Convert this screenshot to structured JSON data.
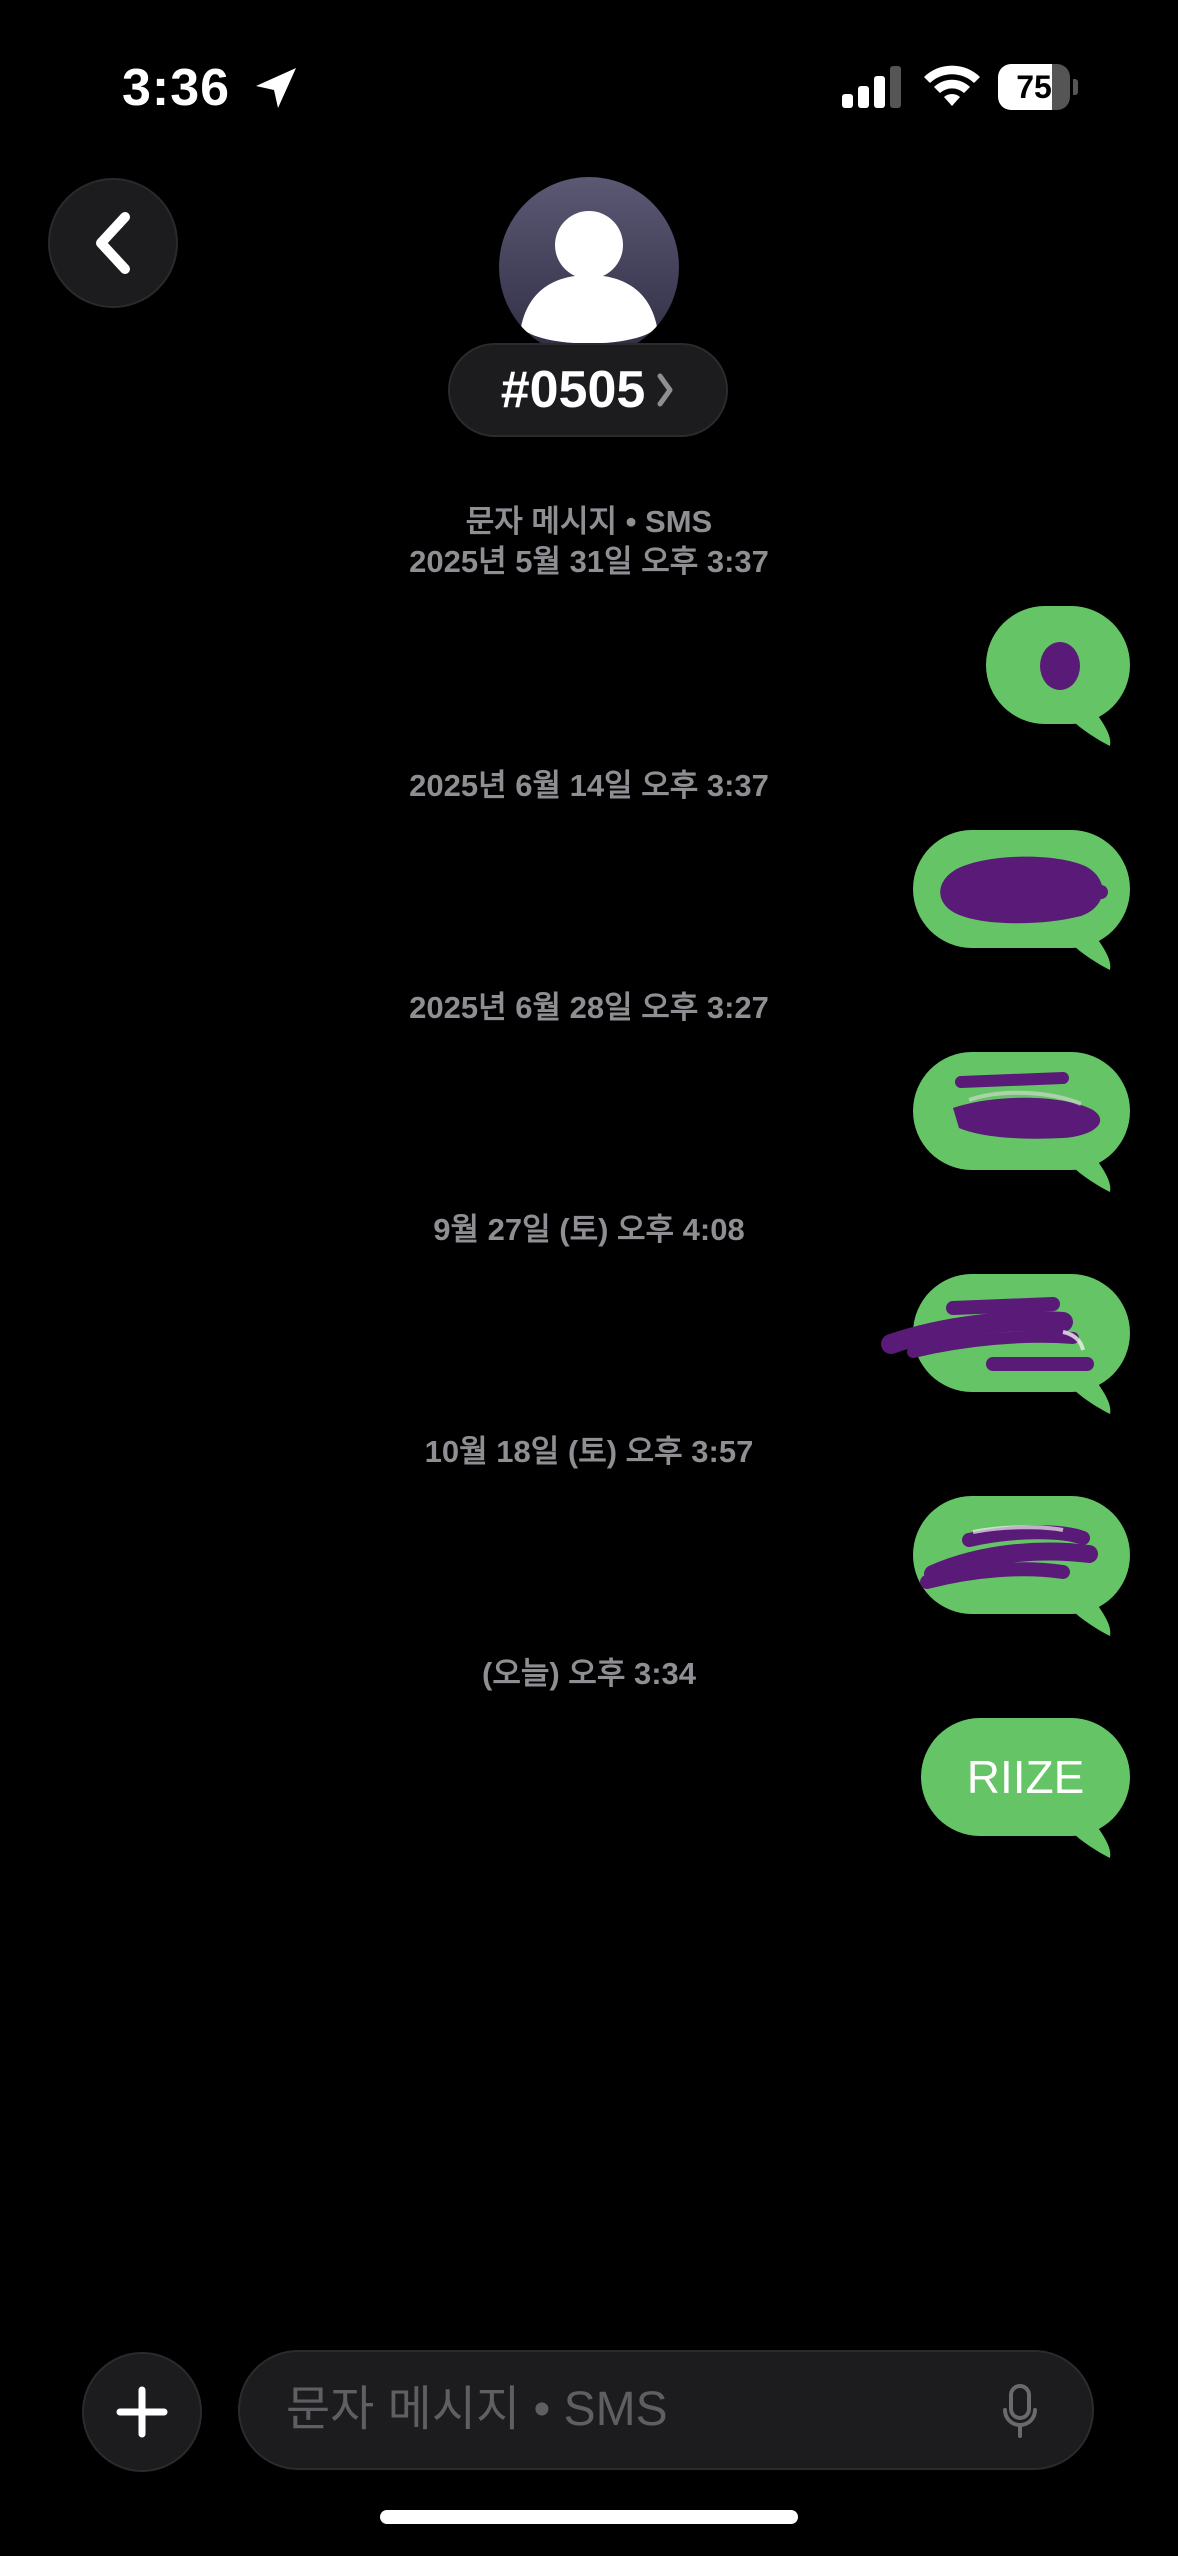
{
  "status_bar": {
    "time": "3:36",
    "battery_percent": "75",
    "battery_level": 0.75,
    "icons": [
      "location-arrow-icon",
      "cellular-signal-icon",
      "wifi-icon",
      "battery-icon"
    ]
  },
  "header": {
    "contact_name": "#0505",
    "icons": [
      "back-chevron-icon",
      "person-icon",
      "chevron-right-icon"
    ]
  },
  "thread": {
    "entries": [
      {
        "stamp": "문자 메시지 • SMS",
        "stamp2": "2025년 5월 31일 오후 3:37",
        "bubble_text": ""
      },
      {
        "stamp": "2025년 6월 14일 오후 3:37",
        "bubble_text": ""
      },
      {
        "stamp": "2025년 6월 28일 오후 3:27",
        "bubble_text": ""
      },
      {
        "stamp": "9월 27일 (토) 오후 4:08",
        "bubble_text": ""
      },
      {
        "stamp": "10월 18일 (토) 오후 3:57",
        "bubble_text": ""
      },
      {
        "stamp": "(오늘) 오후 3:34",
        "bubble_text": "RIIZE"
      }
    ]
  },
  "composer": {
    "placeholder": "문자 메시지 • SMS",
    "icons": [
      "plus-icon",
      "microphone-icon"
    ]
  },
  "colors": {
    "background": "#000000",
    "bubble_green": "#65c466",
    "redaction_purple": "#5a1a78",
    "stamp_gray": "#8e8e93"
  }
}
